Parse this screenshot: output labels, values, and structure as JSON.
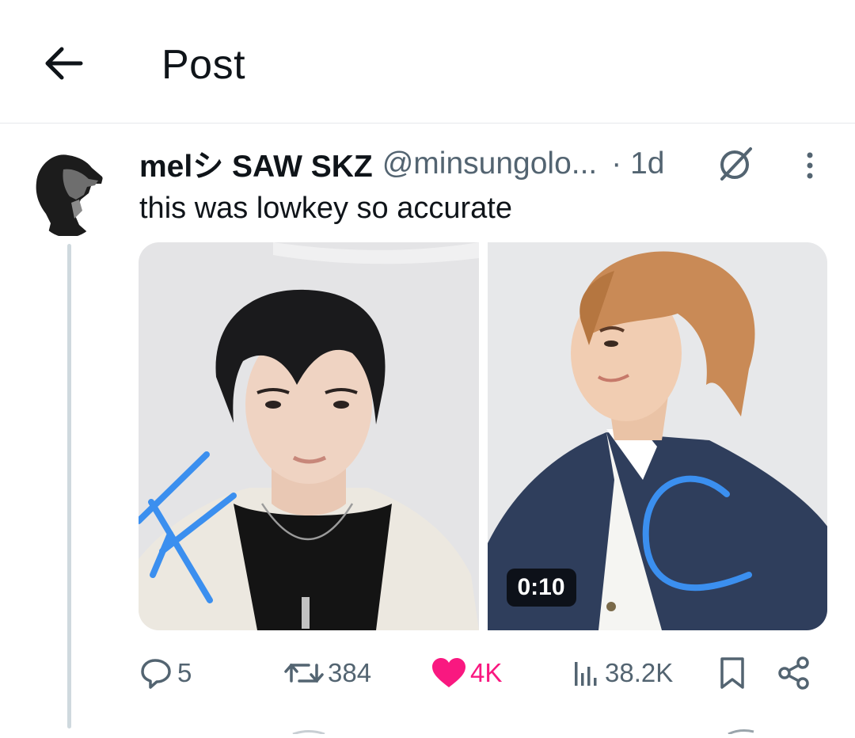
{
  "header": {
    "title": "Post",
    "back_icon": "arrow-left-icon"
  },
  "post": {
    "display_name": "melシ SAW SKZ",
    "handle": "@minsungolo...",
    "time": "· 1d",
    "text": "this was lowkey so accurate",
    "media": {
      "video_duration": "0:10"
    }
  },
  "actions": {
    "replies": "5",
    "reposts": "384",
    "likes": "4K",
    "views": "38.2K"
  },
  "colors": {
    "text": "#0f1419",
    "muted": "#536471",
    "like": "#f91880",
    "divider": "#e6e9ec",
    "thread_line": "#cfd9de",
    "annotation_blue": "#3b8fef"
  }
}
